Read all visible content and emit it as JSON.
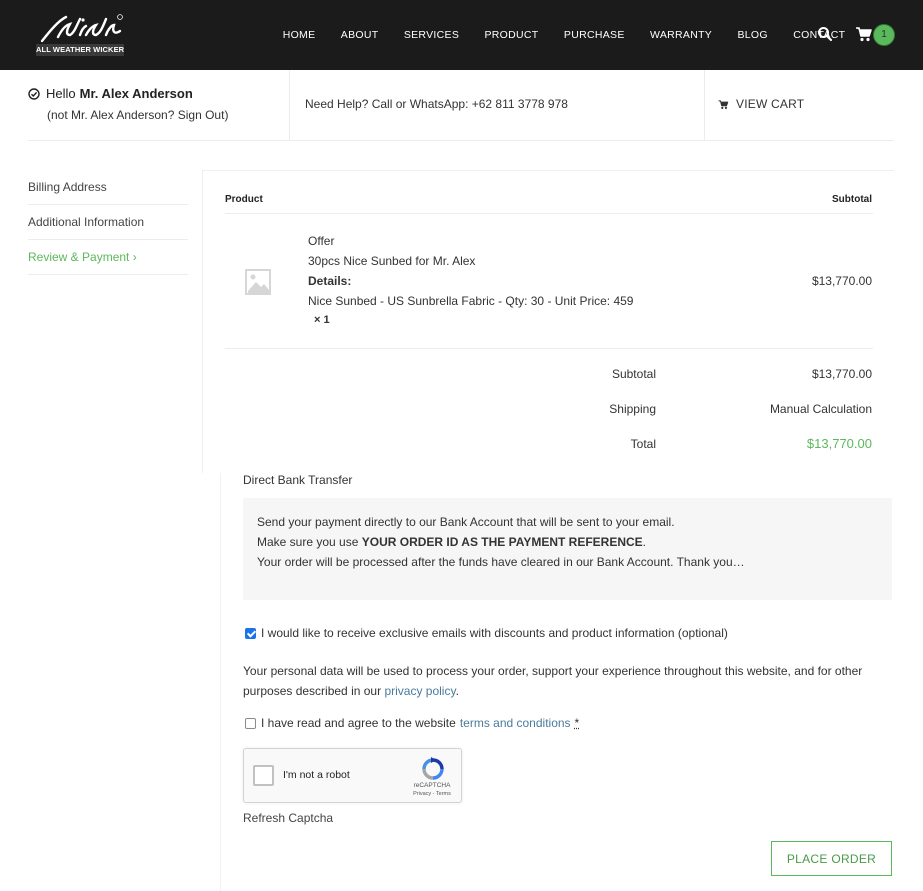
{
  "header": {
    "logo_text": "ALL WEATHER WICKER",
    "nav": [
      {
        "label": "HOME"
      },
      {
        "label": "ABOUT"
      },
      {
        "label": "SERVICES"
      },
      {
        "label": "PRODUCT"
      },
      {
        "label": "PURCHASE"
      },
      {
        "label": "WARRANTY"
      },
      {
        "label": "BLOG"
      },
      {
        "label": "CONTACT"
      }
    ],
    "search_icon": "search-icon",
    "cart_icon": "cart-icon",
    "cart_count": "1",
    "colors": {
      "bar": "#1b1b1b",
      "badge": "#5cb85c"
    }
  },
  "infobar": {
    "hello_prefix": "Hello",
    "user_name": "Mr. Alex Anderson",
    "not_you_prefix": "(not Mr. Alex Anderson?",
    "sign_out": "Sign Out",
    "not_you_suffix": ")",
    "help_text": "Need Help? Call or WhatsApp: +62 811 3778 978",
    "view_cart": "VIEW CART"
  },
  "steps": [
    {
      "label": "Billing Address"
    },
    {
      "label": "Additional Information"
    },
    {
      "label": "Review & Payment ›",
      "active": true
    }
  ],
  "order": {
    "col_product": "Product",
    "col_subtotal": "Subtotal",
    "item": {
      "line1": "Offer",
      "line2": "30pcs Nice Sunbed for Mr. Alex",
      "details_label": "Details:",
      "details": "Nice Sunbed - US Sunbrella Fabric - Qty: 30 - Unit Price: 459",
      "qty": "× 1",
      "price": "$13,770.00"
    },
    "subtotal_label": "Subtotal",
    "subtotal_value": "$13,770.00",
    "shipping_label": "Shipping",
    "shipping_value": "Manual Calculation",
    "total_label": "Total",
    "total_value": "$13,770.00",
    "accent": "#5cb85c"
  },
  "payment": {
    "method": "Direct Bank Transfer",
    "line1": "Send your payment directly to our Bank Account that will be sent to your email.",
    "line2_prefix": "Make sure you use",
    "line2_bold": "YOUR ORDER ID AS THE PAYMENT REFERENCE",
    "line2_suffix": ".",
    "line3": "Your order will be processed after the funds have cleared in our Bank Account. Thank you…",
    "optin_label": "I would like to receive exclusive emails with discounts and product information (optional)",
    "optin_checked": true,
    "privacy_text": "Your personal data will be used to process your order, support your experience throughout this website, and for other purposes described in our",
    "privacy_link": "privacy policy",
    "privacy_end": ".",
    "terms_prefix": "I have read and agree to the website",
    "terms_link": "terms and conditions",
    "terms_required": "*",
    "recaptcha_label": "I'm not a robot",
    "recaptcha_brand": "reCAPTCHA",
    "recaptcha_links": "Privacy - Terms",
    "refresh": "Refresh Captcha",
    "place_order": "PLACE ORDER"
  }
}
